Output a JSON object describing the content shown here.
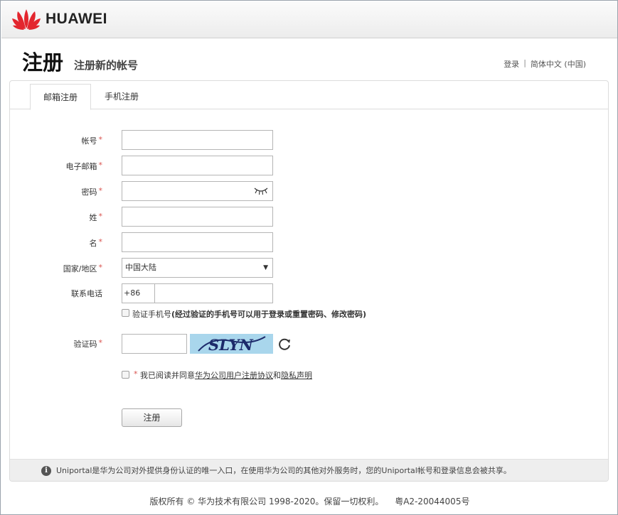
{
  "brand": {
    "name": "HUAWEI",
    "logo_color": "#e3262e"
  },
  "header": {
    "title": "注册",
    "subtitle": "注册新的帐号",
    "login_link": "登录",
    "separator": "|",
    "language": "简体中文 (中国)"
  },
  "tabs": [
    {
      "label": "邮箱注册",
      "active": true
    },
    {
      "label": "手机注册",
      "active": false
    }
  ],
  "form": {
    "account_label": "帐号",
    "email_label": "电子邮箱",
    "password_label": "密码",
    "lastname_label": "姓",
    "firstname_label": "名",
    "country_label": "国家/地区",
    "country_value": "中国大陆",
    "phone_label": "联系电话",
    "phone_code": "+86",
    "required_mark": "*",
    "verify_phone_prefix": "验证手机号",
    "verify_phone_note": "(经过验证的手机号可以用于登录或重置密码、修改密码)",
    "captcha_label": "验证码",
    "captcha_text": "SLYN",
    "agree_prefix": "我已阅读并同意",
    "agree_link1": "华为公司用户注册协议",
    "agree_and": "和",
    "agree_link2": "隐私声明",
    "submit_label": "注册"
  },
  "notice": {
    "text": "Uniportal是华为公司对外提供身份认证的唯一入口，在使用华为公司的其他对外服务时，您的Uniportal帐号和登录信息会被共享。"
  },
  "footer": {
    "copyright": "版权所有 © 华为技术有限公司 1998-2020。保留一切权利。",
    "icp": "粤A2-20044005号"
  },
  "icons": {
    "eye": "eye-closed-icon",
    "refresh": "refresh-icon",
    "info": "info-icon",
    "dropdown": "chevron-down-icon"
  }
}
